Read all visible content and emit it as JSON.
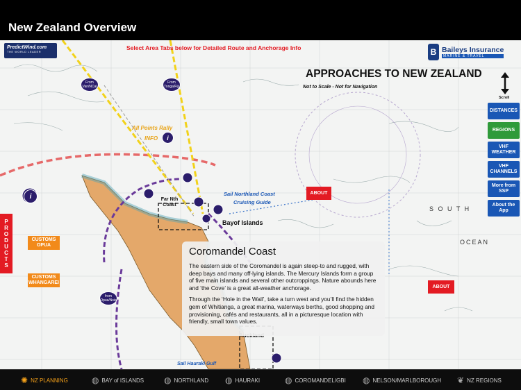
{
  "header": {
    "title": "New Zealand Overview"
  },
  "map": {
    "instruction": "Select Area Tabs below for Detailed Route and Anchorage Info",
    "logo_left_line1": "PredictWind.com",
    "logo_left_line2": "THE WORLD LEADER",
    "logo_right_line1": "Baileys Insurance",
    "logo_right_line2": "MARINE & TRAVEL",
    "heading": "APPROACHES TO NEW ZEALAND",
    "subheading": "Not to Scale - Not for Navigation",
    "scroll_label": "Scroll",
    "rally_label_1": "All Points Rally",
    "rally_label_2": "INFO",
    "sail_northland_1": "Sail Northland Coast",
    "sail_northland_2": "Cruising Guide",
    "bay_label": "Bayof Islands",
    "far_north_label": "Far Nth Coast",
    "auckland_label": "Auckland",
    "sail_hauraki": "Sail Hauraki Gulf",
    "south_label": "S O U T H",
    "ocean_label": "OCEAN",
    "pins": [
      "From Van/NCal",
      "From Tonga/Fiji",
      "from Opua/Nsia"
    ]
  },
  "side_buttons": {
    "distances": "DISTANCES",
    "regions": "REGIONS",
    "vhf_weather": "VHF WEATHER",
    "vhf_channels": "VHF CHANNELS",
    "more_from_ssp": "More from SSP",
    "about_app": "About the App"
  },
  "buttons": {
    "products": [
      "P",
      "R",
      "O",
      "D",
      "U",
      "C",
      "T",
      "S"
    ],
    "customs_opua": "CUSTOMS OPUA",
    "customs_whangarei": "CUSTOMS WHANGAREI",
    "about_1": "ABOUT",
    "about_2": "ABOUT"
  },
  "popup": {
    "title": "Coromandel Coast",
    "para1": "The eastern side of the Coromandel is again steep-to and rugged, with deep bays and many off-lying islands. The Mercury Islands form a group of five main islands and several other outcroppings. Nature abounds here and ‘the Cove’ is a great all-weather anchorage.",
    "para2": "Through the ‘Hole in the Wall’, take a turn west and you’ll find the hidden gem of Whitianga, a great marina, waterways berths, good shopping and provisioning, cafés and restaurants, all in a picturesque location with friendly, small town values."
  },
  "tabs": [
    {
      "label": "NZ PLANNING",
      "icon": "sun-icon",
      "active": true
    },
    {
      "label": "BAY of ISLANDS",
      "icon": "globe-icon",
      "active": false
    },
    {
      "label": "NORTHLAND",
      "icon": "globe-icon",
      "active": false
    },
    {
      "label": "HAURAKI",
      "icon": "globe-icon",
      "active": false
    },
    {
      "label": "COROMANDEL/GBI",
      "icon": "globe-icon",
      "active": false
    },
    {
      "label": "NELSON/MARLBOROUGH",
      "icon": "globe-icon",
      "active": false
    },
    {
      "label": "NZ REGIONS",
      "icon": "fern-icon",
      "active": false
    }
  ],
  "colors": {
    "accent": "#f6a21a",
    "land": "#e4a86a",
    "route_purple": "#5b2d90",
    "route_yellow": "#f2d21a",
    "route_red": "#e31b23"
  }
}
